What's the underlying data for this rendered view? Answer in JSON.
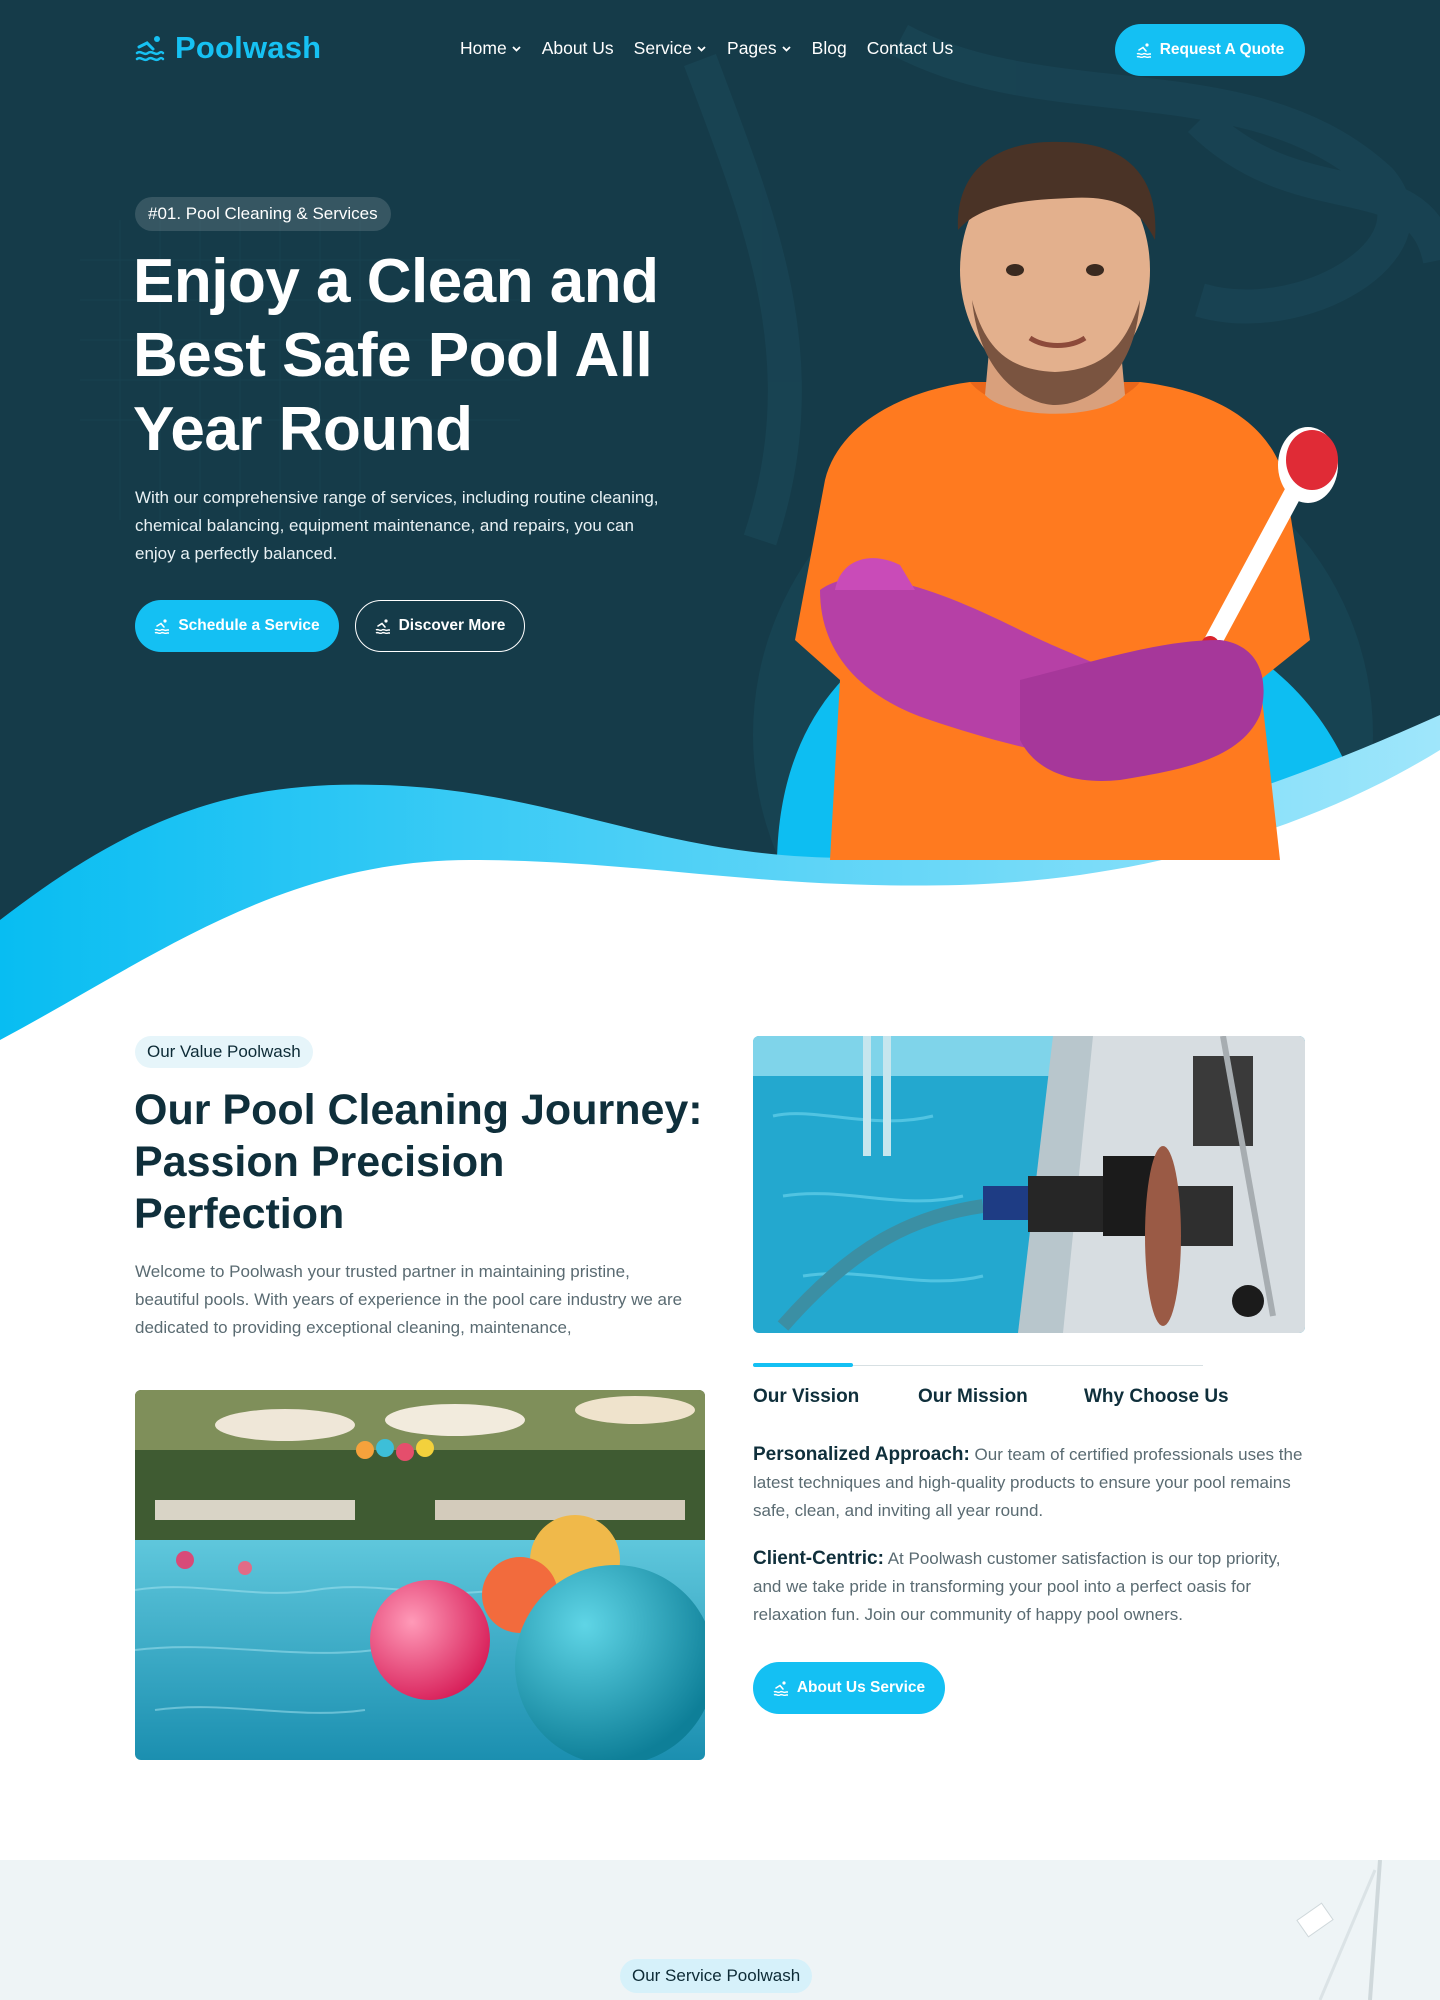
{
  "brand": {
    "name": "Poolwash",
    "accent": "#14c0f3",
    "dark": "#143845"
  },
  "nav": {
    "items": [
      {
        "label": "Home",
        "dropdown": true
      },
      {
        "label": "About Us",
        "dropdown": false
      },
      {
        "label": "Service",
        "dropdown": true
      },
      {
        "label": "Pages",
        "dropdown": true
      },
      {
        "label": "Blog",
        "dropdown": false
      },
      {
        "label": "Contact Us",
        "dropdown": false
      }
    ],
    "cta": "Request A Quote"
  },
  "hero": {
    "tag": "#01. Pool Cleaning & Services",
    "title": "Enjoy a Clean and Best Safe Pool All Year Round",
    "description": "With our comprehensive range of services, including routine cleaning, chemical balancing, equipment maintenance, and repairs, you can enjoy a perfectly balanced.",
    "primary_button": "Schedule a Service",
    "secondary_button": "Discover More"
  },
  "about": {
    "tag": "Our Value Poolwash",
    "title": "Our Pool Cleaning Journey: Passion Precision Perfection",
    "description": "Welcome to Poolwash your trusted partner in maintaining pristine, beautiful pools. With years of experience in the pool care industry we are dedicated to providing exceptional cleaning, maintenance,",
    "tabs": [
      "Our Vission",
      "Our Mission",
      "Why Choose Us"
    ],
    "points": [
      {
        "title": "Personalized Approach:",
        "text": "Our team of certified professionals uses the latest techniques and high-quality products to ensure your pool remains safe, clean, and inviting all year round."
      },
      {
        "title": "Client-Centric:",
        "text": "At Poolwash customer satisfaction is our top priority, and we take pride in transforming your pool into a perfect oasis for relaxation fun. Join our community of happy pool owners."
      }
    ],
    "button": "About Us Service"
  },
  "services": {
    "tag": "Our Service Poolwash"
  },
  "icons": {
    "logo": "swimmer-waves-icon",
    "button": "swimmer-icon",
    "dropdown": "chevron-down-icon"
  }
}
